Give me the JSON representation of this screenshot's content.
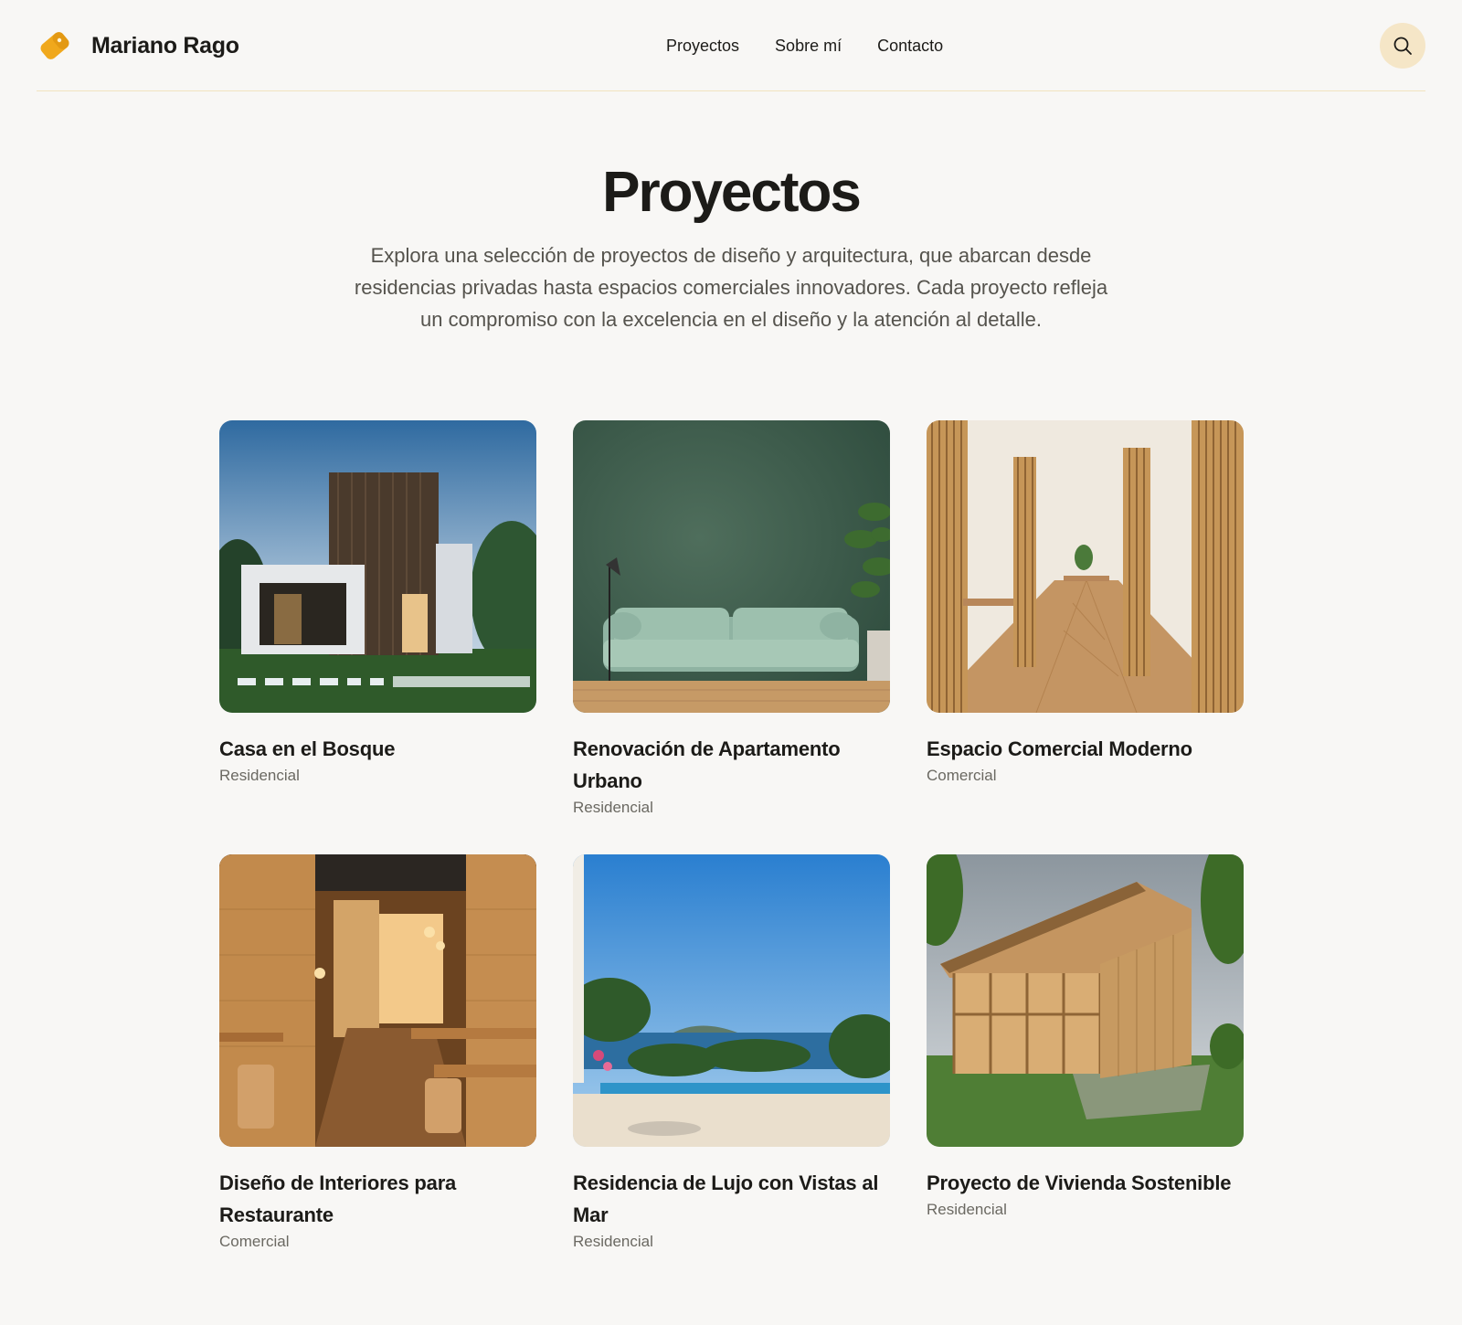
{
  "header": {
    "brand_name": "Mariano Rago",
    "logo_icon": "tag-logo-icon",
    "nav": [
      "Proyectos",
      "Sobre mí",
      "Contacto"
    ],
    "search_icon": "search-icon",
    "colors": {
      "accent": "#f0a81c",
      "search_bg": "#f5e6c7",
      "divider": "#f1e3bf"
    }
  },
  "main": {
    "title": "Proyectos",
    "intro": "Explora una selección de proyectos de diseño y arquitectura, que abarcan desde residencias privadas hasta espacios comerciales innovadores. Cada proyecto refleja un compromiso con la excelencia en el diseño y la atención al detalle."
  },
  "projects": [
    {
      "title": "Casa en el Bosque",
      "category": "Residencial",
      "image": "modern-house-exterior"
    },
    {
      "title": "Renovación de Apartamento Urbano",
      "category": "Residencial",
      "image": "green-wall-living-room"
    },
    {
      "title": "Espacio Comercial Moderno",
      "category": "Comercial",
      "image": "wood-slat-interior"
    },
    {
      "title": "Diseño de Interiores para Restaurante",
      "category": "Comercial",
      "image": "restaurant-interior"
    },
    {
      "title": "Residencia de Lujo con Vistas al Mar",
      "category": "Residencial",
      "image": "infinity-pool-sea-view"
    },
    {
      "title": "Proyecto de Vivienda Sostenible",
      "category": "Residencial",
      "image": "wooden-cabin"
    }
  ]
}
